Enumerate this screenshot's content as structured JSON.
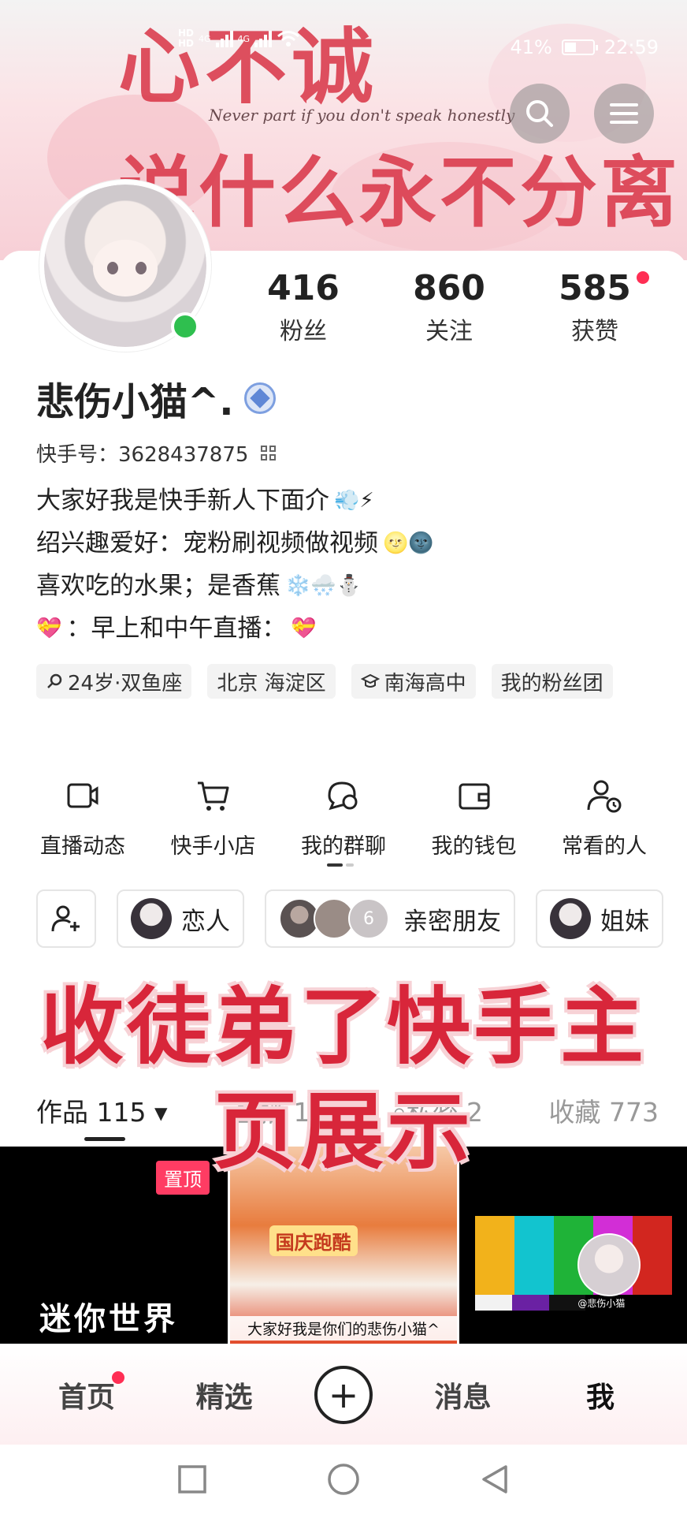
{
  "status_bar": {
    "network": "4G",
    "battery": "41%",
    "battery_level": 0.41,
    "time": "22:59"
  },
  "cover": {
    "title_top": "心不诚",
    "subtitle": "Never part if you don't speak honestly",
    "title_bottom": "说什么永不分离"
  },
  "profile": {
    "name": "悲伤小猫^.",
    "kuaishou_id_label": "快手号：3628437875",
    "stats": [
      {
        "num": "416",
        "label": "粉丝"
      },
      {
        "num": "860",
        "label": "关注"
      },
      {
        "num": "585",
        "label": "获赞"
      }
    ],
    "bio": [
      {
        "text": "大家好我是快手新人下面介",
        "emoji": "💨⚡"
      },
      {
        "text": "绍兴趣爱好：宠粉刷视频做视频",
        "emoji": "🌝🌚"
      },
      {
        "text": "喜欢吃的水果；是香蕉",
        "emoji": "❄️🌨️⛄"
      },
      {
        "text": "：早上和中午直播：",
        "emoji_before": "💝",
        "emoji": "💝"
      }
    ],
    "tags": [
      "24岁·双鱼座",
      "北京 海淀区",
      "南海高中",
      "我的粉丝团"
    ]
  },
  "tools": [
    {
      "label": "直播动态",
      "icon": "live-camera-icon"
    },
    {
      "label": "快手小店",
      "icon": "shopping-cart-icon"
    },
    {
      "label": "我的群聊",
      "icon": "group-chat-icon"
    },
    {
      "label": "我的钱包",
      "icon": "wallet-icon"
    },
    {
      "label": "常看的人",
      "icon": "frequent-people-icon"
    }
  ],
  "friends": [
    {
      "label": "恋人"
    },
    {
      "label": "亲密朋友",
      "count": "6"
    },
    {
      "label": "姐妹"
    }
  ],
  "tabs": [
    {
      "label": "作品 115"
    },
    {
      "label": "直播 17"
    },
    {
      "label": "私密 2"
    },
    {
      "label": "收藏 773"
    }
  ],
  "grid": {
    "pinned": "置顶",
    "cell1_title": "迷你世界",
    "cell2_banner": "国庆跑酷",
    "cell2_caption": "大家好我是你们的悲伤小猫^",
    "cell3_caption": "@悲伤小猫"
  },
  "overlay": {
    "line1": "收徒弟了快手主",
    "line2": "页展示"
  },
  "bottom_nav": {
    "home": "首页",
    "featured": "精选",
    "plus": "+",
    "messages": "消息",
    "me": "我"
  },
  "colors": {
    "accent_red": "#d8263a",
    "online_green": "#2fbf4f",
    "badge_red": "#ff2e54"
  }
}
